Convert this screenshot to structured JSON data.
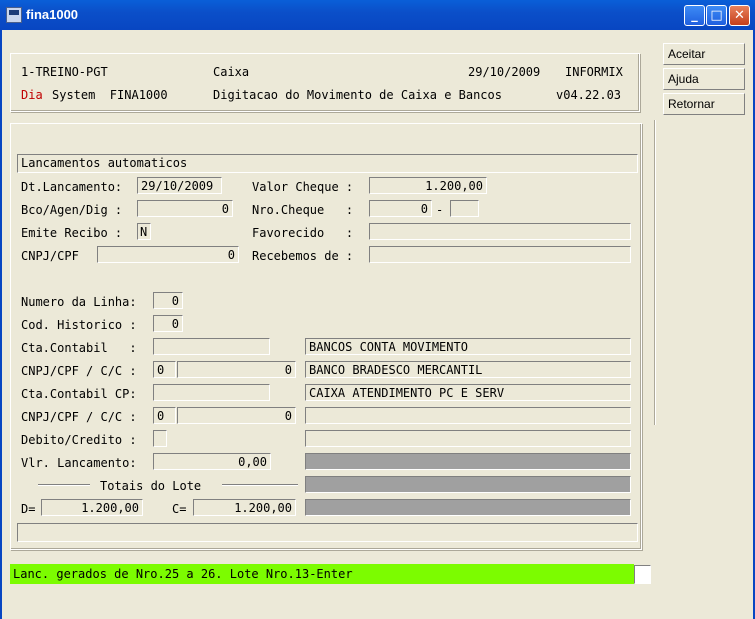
{
  "window": {
    "title": "fina1000"
  },
  "header": {
    "company": "1-TREINO-PGT",
    "module": "Caixa",
    "date": "29/10/2009",
    "db": "INFORMIX",
    "day_label": "Dia",
    "system": "System  FINA1000",
    "description": "Digitacao do Movimento de Caixa e Bancos",
    "version": "v04.22.03"
  },
  "side_buttons": {
    "accept": "Aceitar",
    "help": "Ajuda",
    "return": "Retornar"
  },
  "form": {
    "section_title": "Lancamentos automaticos",
    "dt_lancamento_label": "Dt.Lancamento:",
    "dt_lancamento": "29/10/2009",
    "valor_cheque_label": "Valor Cheque :",
    "valor_cheque": "1.200,00",
    "bco_label": "Bco/Agen/Dig :",
    "bco": "0",
    "nro_cheque_label": "Nro.Cheque   :",
    "nro_cheque": "0",
    "nro_cheque_sep": "-",
    "nro_cheque_dig": "",
    "emite_recibo_label": "Emite Recibo :",
    "emite_recibo": "N",
    "favorecido_label": "Favorecido   :",
    "favorecido": "",
    "cnpj_label": "CNPJ/CPF",
    "cnpj": "0",
    "recebemos_label": "Recebemos de :",
    "recebemos": "",
    "numero_linha_label": "Numero da Linha:",
    "numero_linha": "0",
    "cod_historico_label": "Cod. Historico :",
    "cod_historico": "0",
    "cta_contabil_label": "Cta.Contabil   :",
    "cta_contabil": "",
    "cta_contabil_desc": "BANCOS CONTA MOVIMENTO",
    "cnpj_cc_label": "CNPJ/CPF / C/C :",
    "cnpj_cc_a": "0",
    "cnpj_cc_b": "0",
    "banco_desc": "BANCO BRADESCO MERCANTIL",
    "cta_contabil_cp_label": "Cta.Contabil CP:",
    "cta_contabil_cp": "",
    "cta_contabil_cp_desc": "CAIXA ATENDIMENTO PC E SERV",
    "cnpj_cc2_label": "CNPJ/CPF / C/C :",
    "cnpj_cc2_a": "0",
    "cnpj_cc2_b": "0",
    "cnpj_cc2_desc": "",
    "debito_credito_label": "Debito/Credito :",
    "debito_credito": "",
    "debito_credito_desc": "",
    "vlr_lancamento_label": "Vlr. Lancamento:",
    "vlr_lancamento": "0,00",
    "totais_label": "Totais do Lote",
    "debit_label": "D=",
    "debit_total": "1.200,00",
    "credit_label": "C=",
    "credit_total": "1.200,00"
  },
  "status": {
    "message": "Lanc. gerados de Nro.25 a 26. Lote Nro.13-Enter"
  },
  "colors": {
    "status_bg": "#7cfc00",
    "day_label": "#c00000",
    "titlebar": "#0b4fc9"
  }
}
